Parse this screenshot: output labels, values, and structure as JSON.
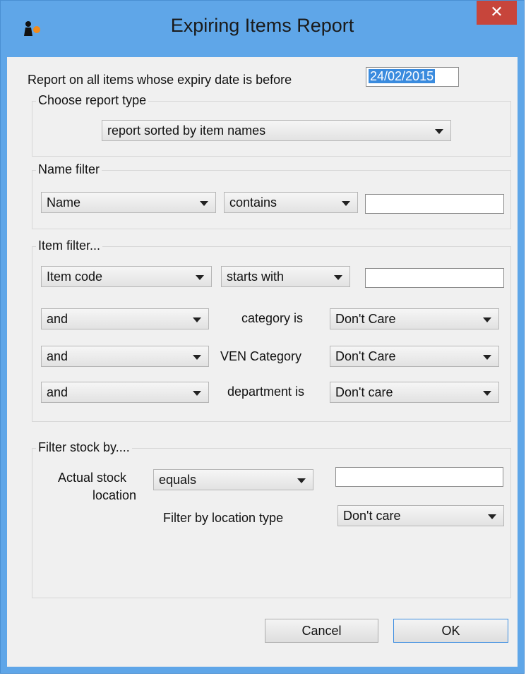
{
  "window": {
    "title": "Expiring Items Report",
    "close_glyph": "✕"
  },
  "expiry": {
    "label": "Report on all items whose expiry date is before",
    "date": "24/02/2015"
  },
  "report_type": {
    "group_title": "Choose report type",
    "selected": "report sorted by item names"
  },
  "name_filter": {
    "group_title": "Name filter",
    "field": "Name",
    "operator": "contains",
    "value": ""
  },
  "item_filter": {
    "group_title": "Item filter...",
    "field": "Item code",
    "operator": "starts with",
    "value": "",
    "rows": [
      {
        "connector": "and",
        "label": "category is",
        "selected": "Don't Care"
      },
      {
        "connector": "and",
        "label": "VEN Category",
        "selected": "Don't Care"
      },
      {
        "connector": "and",
        "label": "department is",
        "selected": "Don't care"
      }
    ]
  },
  "stock_filter": {
    "group_title": "Filter stock by....",
    "location_label_line1": "Actual stock",
    "location_label_line2": "location",
    "operator": "equals",
    "value": "",
    "location_type_label": "Filter by location type",
    "location_type": "Don't care"
  },
  "buttons": {
    "cancel": "Cancel",
    "ok": "OK"
  },
  "colors": {
    "title_bar": "#5fa6e8",
    "close": "#c7453b",
    "dialog_bg": "#f0f0f0",
    "selection": "#3a8bde"
  }
}
